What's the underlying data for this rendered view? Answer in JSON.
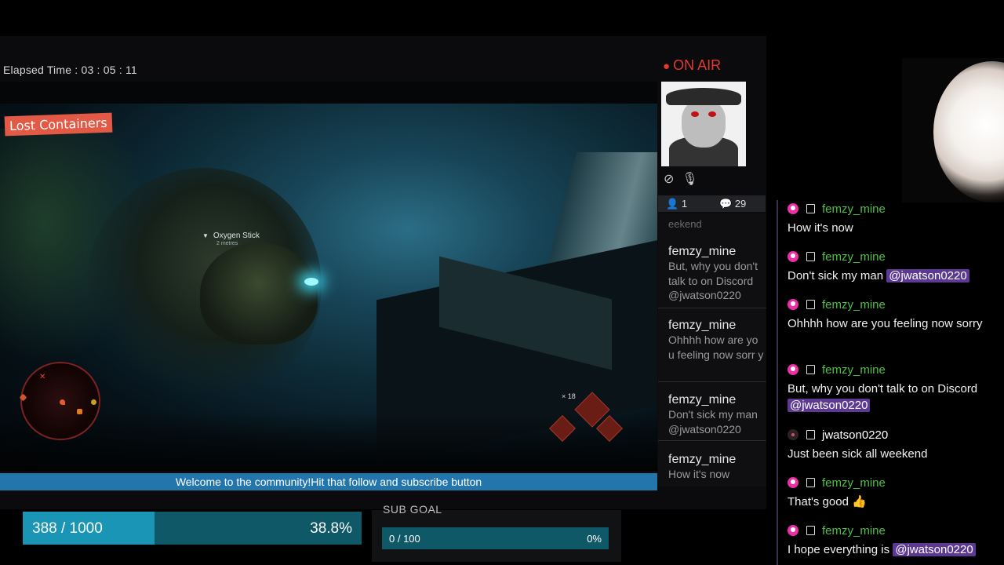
{
  "overlay": {
    "elapsed": "Elapsed Time : 03 : 05 : 11",
    "on_air": "ON AIR",
    "viewers": "1",
    "chat_count": "29",
    "ticker": "Welcome to the community!Hit that follow and subscribe button"
  },
  "game": {
    "objective_title": "Lost Containers",
    "waypoint_label": "Oxygen Stick",
    "waypoint_distance": "2 metres",
    "tool_count": "× 18"
  },
  "mini_chat": {
    "cut_text": "eekend",
    "items": [
      {
        "name": "femzy_mine",
        "text": "But, why you don't talk to on Discord @jwatson0220"
      },
      {
        "name": "femzy_mine",
        "text": "Ohhhh how are yo u feeling now sorr y"
      },
      {
        "name": "femzy_mine",
        "text": "Don't sick my man @jwatson0220"
      },
      {
        "name": "femzy_mine",
        "text": "How it's now"
      }
    ]
  },
  "goals": {
    "follower": {
      "count": "388 / 1000",
      "percent": "38.8%",
      "fraction": 0.388
    },
    "sub": {
      "label": "SUB GOAL",
      "count": "0 / 100",
      "percent": "0%",
      "fraction": 0
    }
  },
  "chat": {
    "messages": [
      {
        "user": "femzy_mine",
        "text": "How it's now"
      },
      {
        "user": "femzy_mine",
        "text": "Don't sick my man",
        "mention": "@jwatson0220"
      },
      {
        "user": "femzy_mine",
        "text": "Ohhhh how are you feeling now sorry"
      },
      {
        "user": "femzy_mine",
        "text": "But, why you don't talk to on Discord",
        "mention": "@jwatson0220"
      },
      {
        "user": "jwatson0220",
        "text": "Just been sick all weekend"
      },
      {
        "user": "femzy_mine",
        "text": "That's good 👍"
      },
      {
        "user": "femzy_mine",
        "text": "I hope everything is",
        "mention": "@jwatson0220"
      }
    ]
  },
  "colors": {
    "accent_blue": "#2376ac",
    "on_air_red": "#e03a2f",
    "chat_name_green": "#4fbf45",
    "mention_purple": "#5c3a94"
  }
}
